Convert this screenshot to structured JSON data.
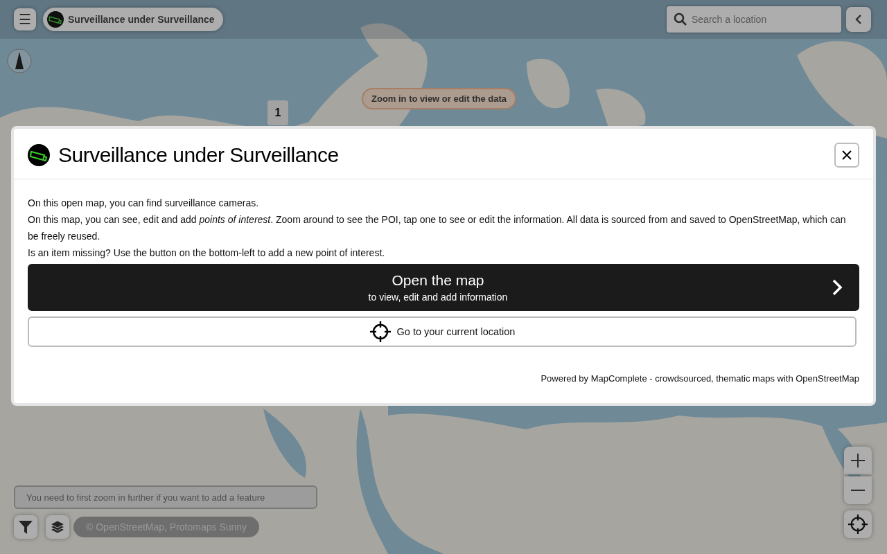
{
  "top_bar": {
    "menu": "☰",
    "theme_title": "Surveillance under Surveillance",
    "search": {
      "placeholder": "Search a location"
    }
  },
  "map": {
    "cluster_count": "1",
    "zoom_hint": "Zoom in to view or edit the data",
    "add_hint": "You need to first zoom in further if you want to add a feature",
    "attribution": "© OpenStreetMap, Protomaps Sunny"
  },
  "dialog": {
    "title": "Surveillance under Surveillance",
    "paragraphs": [
      "On this open map, you can find surveillance cameras.",
      "On this map, you can see, edit and add *points of interest*. Zoom around to see the POI, tap one to see or edit the information. All data is sourced from and saved to OpenStreetMap, which can be freely reused.",
      "Is an item missing? Use the button on the bottom-left to add a new point of interest."
    ],
    "open_button": {
      "label": "Open the map",
      "sublabel": "to view, edit and add information"
    },
    "location_button": "Go to your current location",
    "footer": "Powered by MapComplete - crowdsourced, thematic maps with OpenStreetMap"
  }
}
